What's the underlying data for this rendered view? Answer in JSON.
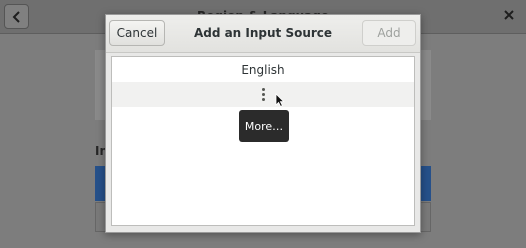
{
  "background_window": {
    "title": "Region & Language",
    "back_icon": "chevron-left-icon",
    "close_icon": "close-icon",
    "section_label": "In"
  },
  "dialog": {
    "title": "Add an Input Source",
    "cancel_label": "Cancel",
    "add_label": "Add",
    "list": {
      "items": [
        {
          "label": "English"
        }
      ],
      "more_icon": "vertical-ellipsis-icon"
    },
    "tooltip": "More…"
  }
}
